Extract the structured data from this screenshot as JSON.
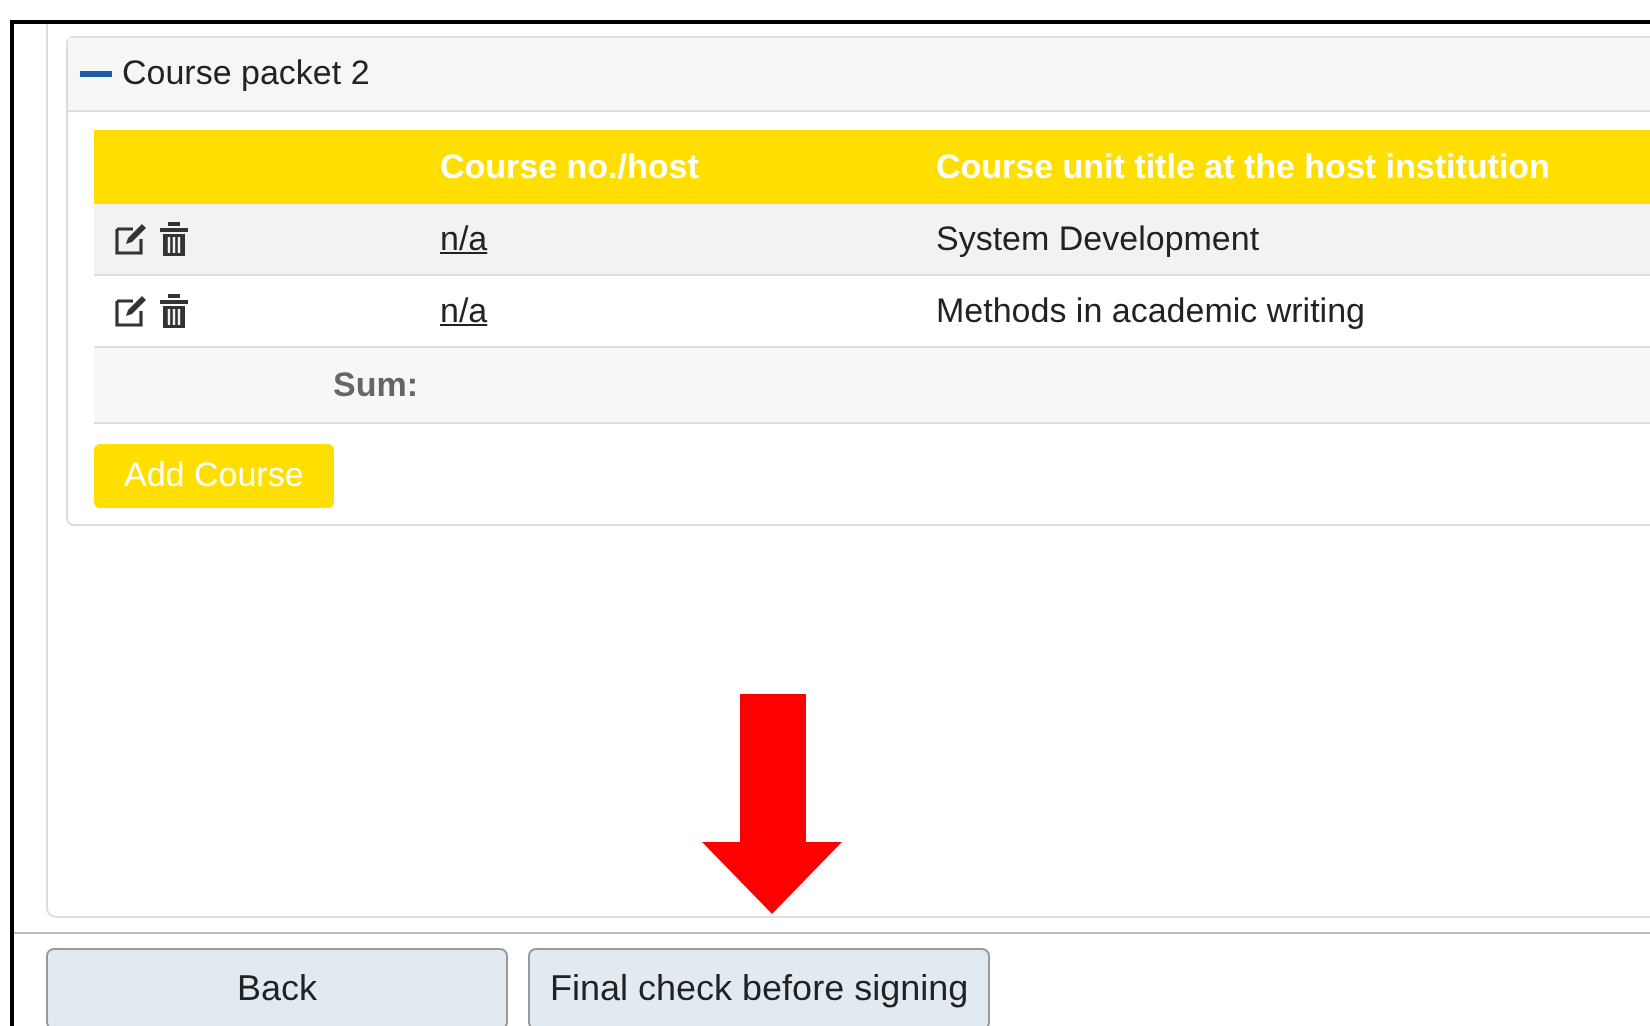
{
  "packet": {
    "title": "Course packet 2",
    "expanded": true,
    "table": {
      "columns": [
        "Course no./host",
        "Course unit title at the host institution"
      ],
      "rows": [
        {
          "course_no": "n/a",
          "title": "System Development"
        },
        {
          "course_no": "n/a",
          "title": "Methods in academic writing"
        }
      ],
      "sum_label": "Sum:"
    },
    "add_button": "Add Course"
  },
  "footer": {
    "buttons": [
      "Back",
      "Final check before signing"
    ]
  }
}
